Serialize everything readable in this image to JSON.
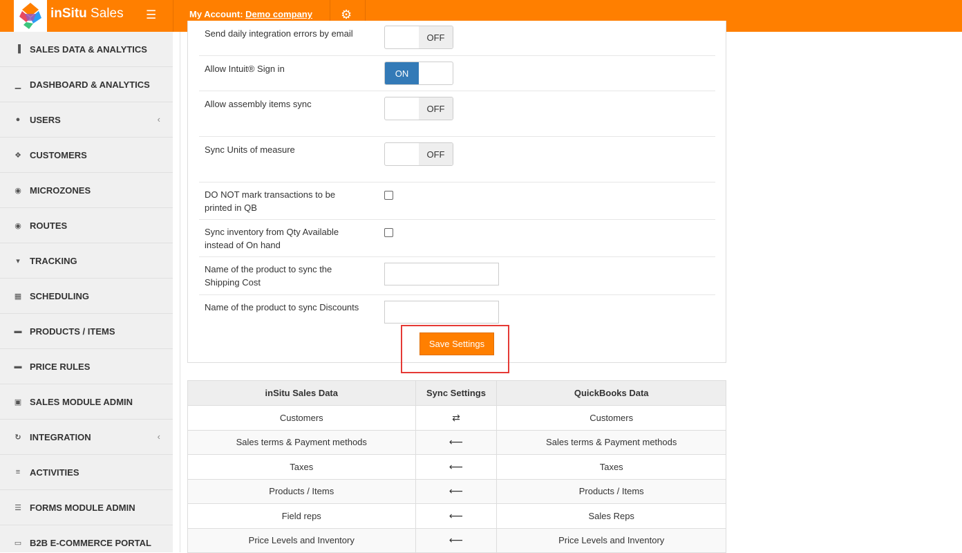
{
  "header": {
    "brand_bold": "inSitu",
    "brand_light": " Sales",
    "account_label": "My Account:",
    "account_name": "Demo company"
  },
  "sidebar": {
    "items": [
      {
        "label": "SALES DATA & ANALYTICS",
        "icon": "bar-chart-icon"
      },
      {
        "label": "DASHBOARD & ANALYTICS",
        "icon": "signal-icon"
      },
      {
        "label": "USERS",
        "icon": "user-icon",
        "chevron": true
      },
      {
        "label": "CUSTOMERS",
        "icon": "users-icon"
      },
      {
        "label": "MICROZONES",
        "icon": "globe-icon"
      },
      {
        "label": "ROUTES",
        "icon": "globe-icon"
      },
      {
        "label": "TRACKING",
        "icon": "map-marker-icon"
      },
      {
        "label": "SCHEDULING",
        "icon": "calendar-icon"
      },
      {
        "label": "PRODUCTS / ITEMS",
        "icon": "briefcase-icon"
      },
      {
        "label": "PRICE RULES",
        "icon": "briefcase-icon"
      },
      {
        "label": "SALES MODULE ADMIN",
        "icon": "suitcase-icon"
      },
      {
        "label": "INTEGRATION",
        "icon": "refresh-icon",
        "chevron": true
      },
      {
        "label": "ACTIVITIES",
        "icon": "tasks-icon"
      },
      {
        "label": "FORMS MODULE ADMIN",
        "icon": "list-icon"
      },
      {
        "label": "B2B E-COMMERCE PORTAL",
        "icon": "cart-icon"
      }
    ]
  },
  "settings": {
    "daily_errors_label": "Send daily integration errors by email",
    "daily_errors_state": "OFF",
    "intuit_label": "Allow Intuit® Sign in",
    "intuit_state": "ON",
    "assembly_label": "Allow assembly items sync",
    "assembly_state": "OFF",
    "uom_label": "Sync Units of measure",
    "uom_state": "OFF",
    "no_print_label_1": "DO NOT mark transactions to be",
    "no_print_label_2": "printed in QB",
    "qty_label_1": "Sync inventory from Qty Available",
    "qty_label_2": "instead of On hand",
    "shipping_label_1": "Name of the product to sync the",
    "shipping_label_2": "Shipping Cost",
    "discounts_label": "Name of the product to sync Discounts",
    "save_label": "Save Settings"
  },
  "sync_table": {
    "headers": [
      "inSitu Sales Data",
      "Sync Settings",
      "QuickBooks Data"
    ],
    "rows": [
      {
        "left": "Customers",
        "dir": "⇄",
        "right": "Customers"
      },
      {
        "left": "Sales terms & Payment methods",
        "dir": "⟵",
        "right": "Sales terms & Payment methods"
      },
      {
        "left": "Taxes",
        "dir": "⟵",
        "right": "Taxes"
      },
      {
        "left": "Products / Items",
        "dir": "⟵",
        "right": "Products / Items"
      },
      {
        "left": "Field reps",
        "dir": "⟵",
        "right": "Sales Reps"
      },
      {
        "left": "Price Levels and Inventory",
        "dir": "⟵",
        "right": "Price Levels and Inventory"
      }
    ]
  },
  "colors": {
    "brand_orange": "#ff7f00",
    "toggle_on_blue": "#337ab7",
    "highlight_red": "#e53935"
  }
}
